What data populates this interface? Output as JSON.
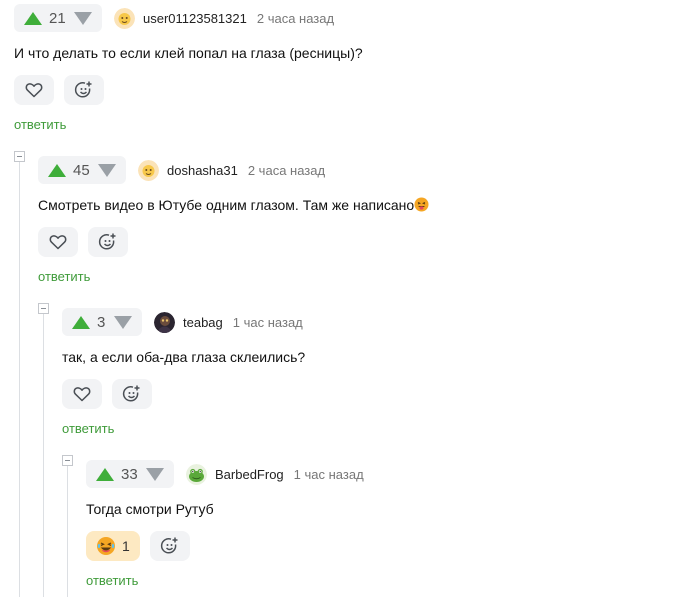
{
  "comments": [
    {
      "votes": "21",
      "username": "user01123581321",
      "time": "2 часа назад",
      "text": "И что делать то если клей попал на глаза (ресницы)?",
      "reply_label": "ответить"
    },
    {
      "votes": "45",
      "username": "doshasha31",
      "time": "2 часа назад",
      "text": "Смотреть видео в Ютубе одним глазом. Там же написано",
      "reply_label": "ответить"
    },
    {
      "votes": "3",
      "username": "teabag",
      "time": "1 час назад",
      "text": "так, а если оба-два глаза склеились?",
      "reply_label": "ответить"
    },
    {
      "votes": "33",
      "username": "BarbedFrog",
      "time": "1 час назад",
      "text": "Тогда смотри Рутуб",
      "reaction_count": "1",
      "reply_label": "ответить"
    }
  ],
  "icons": {
    "upvote": "upvote-icon",
    "downvote": "downvote-icon",
    "like": "heart-icon",
    "add_reaction": "add-reaction-icon",
    "emoji_laugh": "laughing-emoji-icon",
    "emoji_tongue": "tongue-emoji-icon",
    "collapse": "collapse-icon"
  },
  "colors": {
    "upvote": "#3fae3a",
    "downvote": "#9aa0a6",
    "reply_link": "#3f9b3a",
    "pill_bg": "#f2f3f5",
    "reaction_bg": "#fde9c2"
  }
}
